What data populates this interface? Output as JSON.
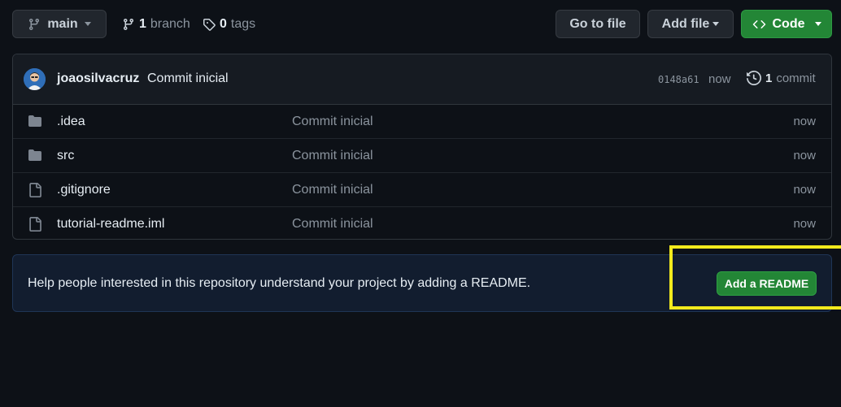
{
  "toolbar": {
    "branch_name": "main",
    "branch_count": "1",
    "branch_label": "branch",
    "tag_count": "0",
    "tag_label": "tags",
    "go_to_file": "Go to file",
    "add_file": "Add file",
    "code": "Code"
  },
  "latest_commit": {
    "author": "joaosilvacruz",
    "message": "Commit inicial",
    "sha": "0148a61",
    "time": "now",
    "count": "1",
    "count_label": "commit"
  },
  "files": [
    {
      "name": ".idea",
      "type": "folder",
      "commit": "Commit inicial",
      "age": "now"
    },
    {
      "name": "src",
      "type": "folder",
      "commit": "Commit inicial",
      "age": "now"
    },
    {
      "name": ".gitignore",
      "type": "file",
      "commit": "Commit inicial",
      "age": "now"
    },
    {
      "name": "tutorial-readme.iml",
      "type": "file",
      "commit": "Commit inicial",
      "age": "now"
    }
  ],
  "readme_banner": {
    "text": "Help people interested in this repository understand your project by adding a README.",
    "button": "Add a README"
  },
  "colors": {
    "background": "#0d1117",
    "accent_green": "#238636",
    "highlight": "#f2ea1d"
  }
}
